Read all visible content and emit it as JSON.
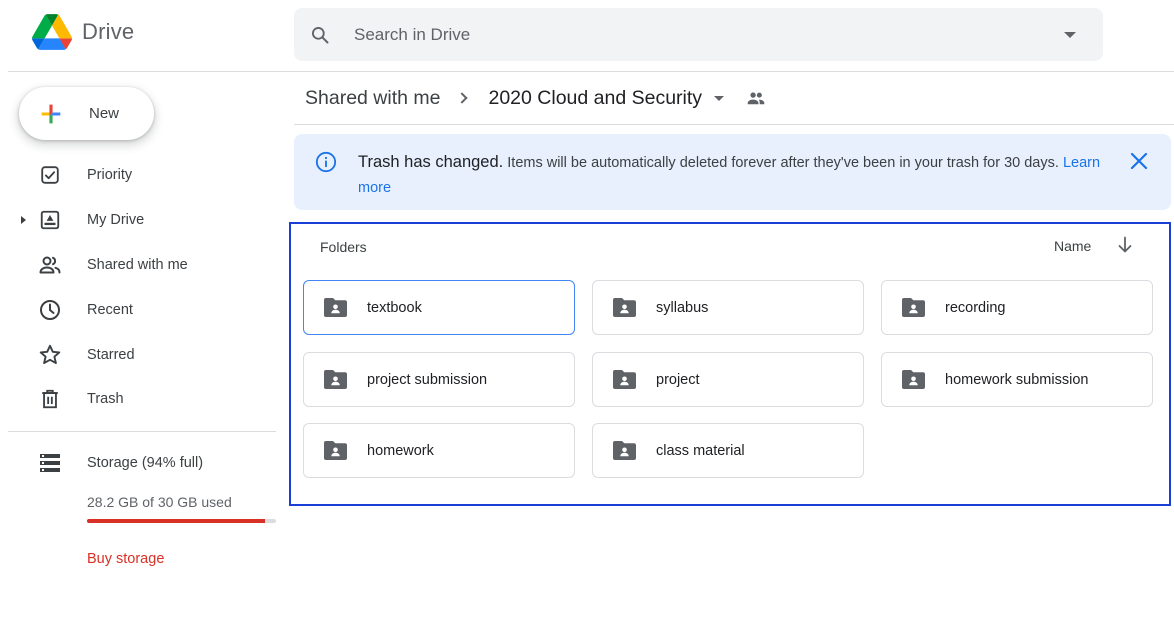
{
  "app": {
    "name": "Drive"
  },
  "search": {
    "placeholder": "Search in Drive",
    "value": ""
  },
  "new_button": {
    "label": "New"
  },
  "sidebar": {
    "items": [
      {
        "label": "Priority",
        "icon": "priority-icon"
      },
      {
        "label": "My Drive",
        "icon": "my-drive-icon",
        "expandable": true
      },
      {
        "label": "Shared with me",
        "icon": "shared-with-me-icon"
      },
      {
        "label": "Recent",
        "icon": "recent-icon"
      },
      {
        "label": "Starred",
        "icon": "star-icon"
      },
      {
        "label": "Trash",
        "icon": "trash-icon"
      }
    ],
    "storage": {
      "label": "Storage (94% full)",
      "used_text": "28.2 GB of 30 GB used",
      "fraction_used": 0.94,
      "buy_label": "Buy storage"
    }
  },
  "breadcrumb": {
    "parent": "Shared with me",
    "current": "2020 Cloud and Security"
  },
  "banner": {
    "title": "Trash has changed.",
    "message": "Items will be automatically deleted forever after they've been in your trash for 30 days.",
    "link": "Learn more"
  },
  "folders_section": {
    "heading": "Folders",
    "sort_label": "Name",
    "items": [
      {
        "name": "textbook",
        "selected": true
      },
      {
        "name": "syllabus",
        "selected": false
      },
      {
        "name": "recording",
        "selected": false
      },
      {
        "name": "project submission",
        "selected": false
      },
      {
        "name": "project",
        "selected": false
      },
      {
        "name": "homework submission",
        "selected": false
      },
      {
        "name": "homework",
        "selected": false
      },
      {
        "name": "class material",
        "selected": false
      }
    ]
  },
  "colors": {
    "accent": "#1a73e8",
    "storage_bar": "#d93025",
    "banner_bg": "#e8f0fe",
    "selection_border": "#1a3fd6",
    "folder_icon": "#5f6368"
  }
}
